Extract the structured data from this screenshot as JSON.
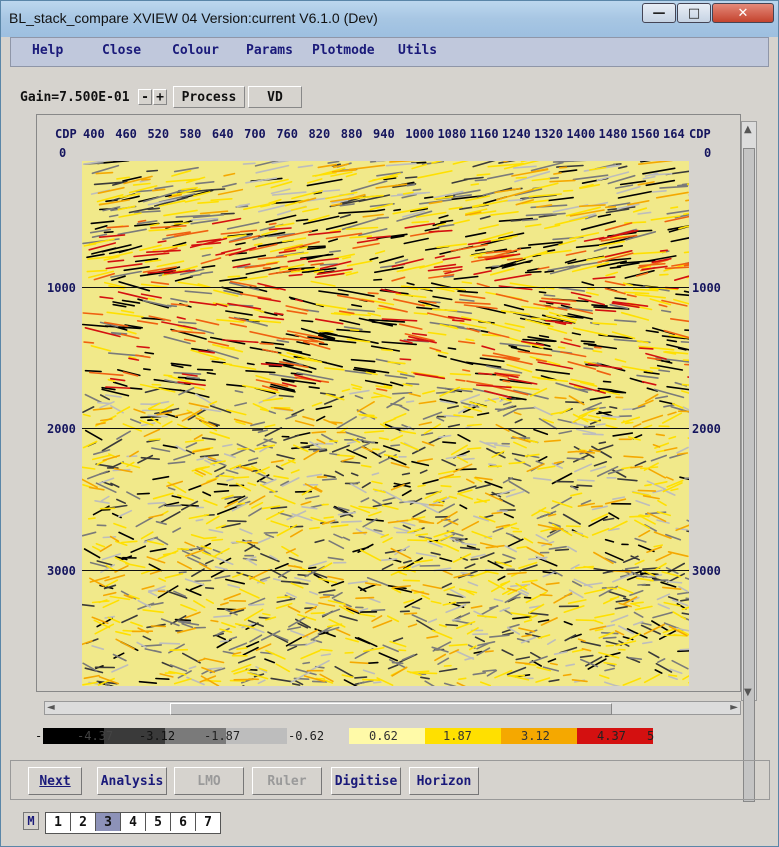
{
  "window": {
    "title": "BL_stack_compare XVIEW 04   Version:current V6.1.0 (Dev)",
    "minimize_glyph": "—",
    "maximize_glyph": "□",
    "close_glyph": "✕"
  },
  "menu": [
    "Help",
    "Close",
    "Colour",
    "Params",
    "Plotmode",
    "Utils"
  ],
  "toolbar": {
    "gain_label": "Gain=7.500E-01",
    "minus": "-",
    "plus": "+",
    "process": "Process",
    "vd": "VD"
  },
  "axes": {
    "cdp_label": "CDP",
    "cdp_ticks": [
      "400",
      "460",
      "520",
      "580",
      "640",
      "700",
      "760",
      "820",
      "880",
      "940",
      "1000",
      "1080",
      "1160",
      "1240",
      "1320",
      "1400",
      "1480",
      "1560",
      "164"
    ],
    "time_ticks": [
      "0",
      "1000",
      "2000",
      "3000"
    ]
  },
  "colorbar": {
    "colors": [
      "#000000",
      "#3a3a3a",
      "#7a7a7a",
      "#bdbdbd",
      "#fffaa8",
      "#ffe000",
      "#f5a800",
      "#f06010",
      "#d41010"
    ],
    "labels": [
      "-4.37",
      "-3.12",
      "-1.87",
      "-0.62",
      "0.62",
      "1.87",
      "3.12",
      "4.37"
    ],
    "end_labels": [
      "-",
      "5"
    ]
  },
  "bottom_buttons": [
    {
      "label": "Next",
      "enabled": true
    },
    {
      "label": "Analysis",
      "enabled": true
    },
    {
      "label": "LMO",
      "enabled": false
    },
    {
      "label": "Ruler",
      "enabled": false
    },
    {
      "label": "Digitise",
      "enabled": true
    },
    {
      "label": "Horizon",
      "enabled": true
    }
  ],
  "mode_button": "M",
  "pages": [
    "1",
    "2",
    "3",
    "4",
    "5",
    "6",
    "7"
  ],
  "selected_page": "3",
  "icons": {
    "scroll_up": "▲",
    "scroll_down": "▼",
    "scroll_left": "◄",
    "scroll_right": "►"
  }
}
